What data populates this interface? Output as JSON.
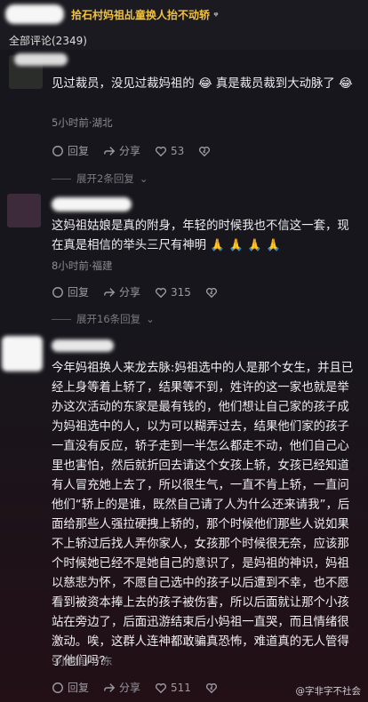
{
  "header": {
    "tag_title": "拾石村妈祖乩童换人抬不动轿",
    "search_glyph": "ᵠ",
    "comments_label": "全部评论(2349)"
  },
  "comments": [
    {
      "text": "见过裁员，没见过裁妈祖的 😂 真是裁员裁到大动脉了 😂",
      "meta": "5小时前·湖北",
      "reply": "回复",
      "share": "分享",
      "likes": "53",
      "expand": "展开2条回复"
    },
    {
      "text": "这妈祖姑娘是真的附身，年轻的时候我也不信这一套，现在真是相信的举头三尺有神明 🙏 🙏 🙏 🙏",
      "meta": "8小时前·福建",
      "reply": "回复",
      "share": "分享",
      "likes": "315",
      "expand": "展开16条回复"
    },
    {
      "text": "今年妈祖换人来龙去脉:妈祖选中的人是那个女生，并且已经上身等着上轿了，结果等不到，姓许的这一家也就是举办这次活动的东家是最有钱的，他们想让自己家的孩子成为妈祖选中的人，以为可以糊弄过去，结果他们家的孩子一直没有反应，轿子走到一半怎么都走不动，他们自己心里也害怕，然后就折回去请这个女孩上轿，女孩已经知道有人冒充她上去了，所以很生气，一直不肯上轿，一直问他们“轿上的是谁，既然自己请了人为什么还来请我”，后面给那些人强拉硬拽上轿的，那个时候他们那些人说如果不上轿过后找人弄你家人，女孩那个时候很无奈，应该那个时候她已经不是她自己的意识了，是妈祖的神识，妈祖以慈悲为怀，不愿自己选中的孩子以后遭到不幸，也不愿看到被资本捧上去的孩子被伤害，所以后面就让那个小孩站在旁边了，后面迅游结束后小妈祖一直哭，而且情绪很激动。唉，这群人连神都敢骗真恐怖，难道真的无人管得了他们吗?",
      "meta": "9小时前·广东",
      "reply": "回复",
      "share": "分享",
      "likes": "511"
    }
  ],
  "watermark": "@字非字不社会"
}
